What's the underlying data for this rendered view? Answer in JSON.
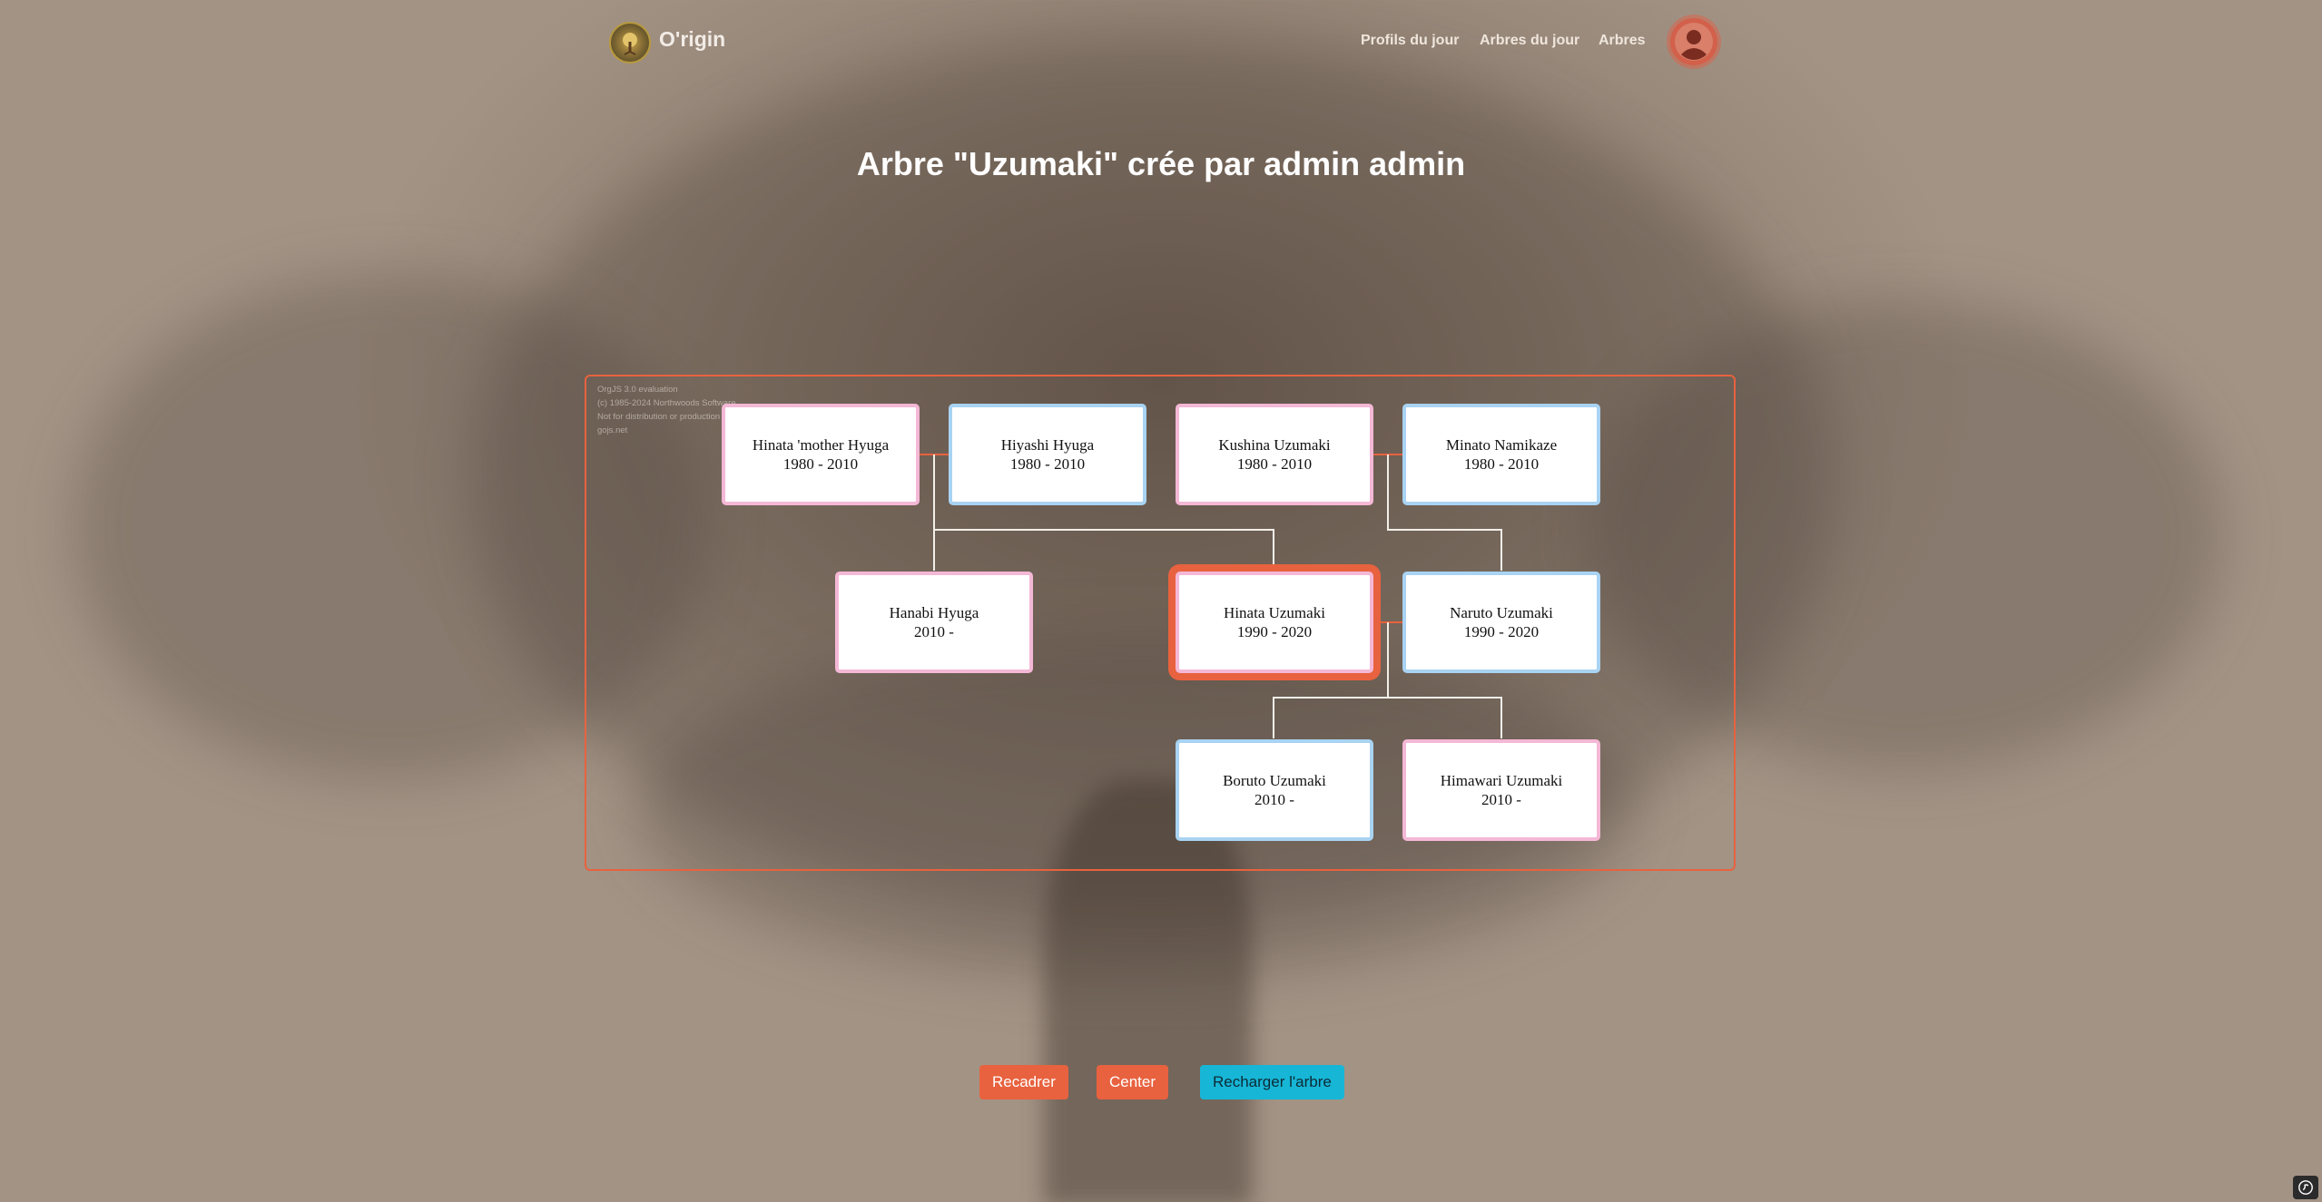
{
  "header": {
    "brand": "O'rigin",
    "nav": [
      "Profils du jour",
      "Arbres du jour",
      "Arbres"
    ]
  },
  "page_title": "Arbre \"Uzumaki\" crée par admin admin",
  "watermark": {
    "line1": "OrgJS 3.0 evaluation",
    "line2": "(c) 1985-2024 Northwoods Software",
    "line3": "Not for distribution or production use",
    "line4": "gojs.net"
  },
  "people": [
    {
      "name": "Hinata 'mother Hyuga",
      "years": "1980 - 2010",
      "gender": "female"
    },
    {
      "name": "Hiyashi Hyuga",
      "years": "1980 - 2010",
      "gender": "male"
    },
    {
      "name": "Kushina Uzumaki",
      "years": "1980 - 2010",
      "gender": "female"
    },
    {
      "name": "Minato Namikaze",
      "years": "1980 - 2010",
      "gender": "male"
    },
    {
      "name": "Hanabi Hyuga",
      "years": "2010 -",
      "gender": "female"
    },
    {
      "name": "Hinata Uzumaki",
      "years": "1990 - 2020",
      "gender": "female",
      "selected": true
    },
    {
      "name": "Naruto Uzumaki",
      "years": "1990 - 2020",
      "gender": "male"
    },
    {
      "name": "Boruto Uzumaki",
      "years": "2010 -",
      "gender": "male"
    },
    {
      "name": "Himawari Uzumaki",
      "years": "2010 -",
      "gender": "female"
    }
  ],
  "buttons": {
    "recadrer": "Recadrer",
    "center": "Center",
    "recharger": "Recharger l'arbre"
  },
  "colors": {
    "accent": "#e8623f",
    "female_border": "#f4b8d6",
    "male_border": "#a9d3f2",
    "cyan_button": "#17b6d6"
  }
}
